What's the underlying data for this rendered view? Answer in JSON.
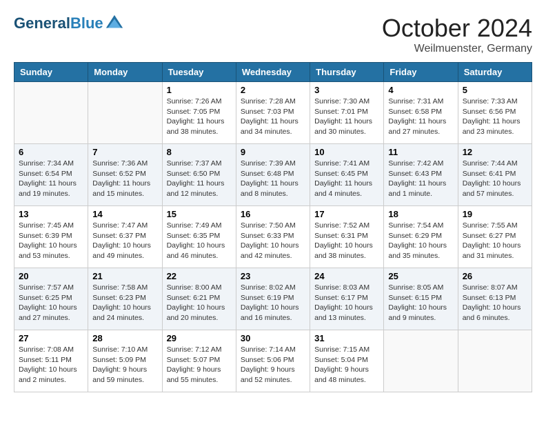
{
  "header": {
    "logo_line1": "General",
    "logo_line2": "Blue",
    "month_title": "October 2024",
    "subtitle": "Weilmuenster, Germany"
  },
  "weekdays": [
    "Sunday",
    "Monday",
    "Tuesday",
    "Wednesday",
    "Thursday",
    "Friday",
    "Saturday"
  ],
  "weeks": [
    [
      {
        "day": "",
        "sunrise": "",
        "sunset": "",
        "daylight": ""
      },
      {
        "day": "",
        "sunrise": "",
        "sunset": "",
        "daylight": ""
      },
      {
        "day": "1",
        "sunrise": "Sunrise: 7:26 AM",
        "sunset": "Sunset: 7:05 PM",
        "daylight": "Daylight: 11 hours and 38 minutes."
      },
      {
        "day": "2",
        "sunrise": "Sunrise: 7:28 AM",
        "sunset": "Sunset: 7:03 PM",
        "daylight": "Daylight: 11 hours and 34 minutes."
      },
      {
        "day": "3",
        "sunrise": "Sunrise: 7:30 AM",
        "sunset": "Sunset: 7:01 PM",
        "daylight": "Daylight: 11 hours and 30 minutes."
      },
      {
        "day": "4",
        "sunrise": "Sunrise: 7:31 AM",
        "sunset": "Sunset: 6:58 PM",
        "daylight": "Daylight: 11 hours and 27 minutes."
      },
      {
        "day": "5",
        "sunrise": "Sunrise: 7:33 AM",
        "sunset": "Sunset: 6:56 PM",
        "daylight": "Daylight: 11 hours and 23 minutes."
      }
    ],
    [
      {
        "day": "6",
        "sunrise": "Sunrise: 7:34 AM",
        "sunset": "Sunset: 6:54 PM",
        "daylight": "Daylight: 11 hours and 19 minutes."
      },
      {
        "day": "7",
        "sunrise": "Sunrise: 7:36 AM",
        "sunset": "Sunset: 6:52 PM",
        "daylight": "Daylight: 11 hours and 15 minutes."
      },
      {
        "day": "8",
        "sunrise": "Sunrise: 7:37 AM",
        "sunset": "Sunset: 6:50 PM",
        "daylight": "Daylight: 11 hours and 12 minutes."
      },
      {
        "day": "9",
        "sunrise": "Sunrise: 7:39 AM",
        "sunset": "Sunset: 6:48 PM",
        "daylight": "Daylight: 11 hours and 8 minutes."
      },
      {
        "day": "10",
        "sunrise": "Sunrise: 7:41 AM",
        "sunset": "Sunset: 6:45 PM",
        "daylight": "Daylight: 11 hours and 4 minutes."
      },
      {
        "day": "11",
        "sunrise": "Sunrise: 7:42 AM",
        "sunset": "Sunset: 6:43 PM",
        "daylight": "Daylight: 11 hours and 1 minute."
      },
      {
        "day": "12",
        "sunrise": "Sunrise: 7:44 AM",
        "sunset": "Sunset: 6:41 PM",
        "daylight": "Daylight: 10 hours and 57 minutes."
      }
    ],
    [
      {
        "day": "13",
        "sunrise": "Sunrise: 7:45 AM",
        "sunset": "Sunset: 6:39 PM",
        "daylight": "Daylight: 10 hours and 53 minutes."
      },
      {
        "day": "14",
        "sunrise": "Sunrise: 7:47 AM",
        "sunset": "Sunset: 6:37 PM",
        "daylight": "Daylight: 10 hours and 49 minutes."
      },
      {
        "day": "15",
        "sunrise": "Sunrise: 7:49 AM",
        "sunset": "Sunset: 6:35 PM",
        "daylight": "Daylight: 10 hours and 46 minutes."
      },
      {
        "day": "16",
        "sunrise": "Sunrise: 7:50 AM",
        "sunset": "Sunset: 6:33 PM",
        "daylight": "Daylight: 10 hours and 42 minutes."
      },
      {
        "day": "17",
        "sunrise": "Sunrise: 7:52 AM",
        "sunset": "Sunset: 6:31 PM",
        "daylight": "Daylight: 10 hours and 38 minutes."
      },
      {
        "day": "18",
        "sunrise": "Sunrise: 7:54 AM",
        "sunset": "Sunset: 6:29 PM",
        "daylight": "Daylight: 10 hours and 35 minutes."
      },
      {
        "day": "19",
        "sunrise": "Sunrise: 7:55 AM",
        "sunset": "Sunset: 6:27 PM",
        "daylight": "Daylight: 10 hours and 31 minutes."
      }
    ],
    [
      {
        "day": "20",
        "sunrise": "Sunrise: 7:57 AM",
        "sunset": "Sunset: 6:25 PM",
        "daylight": "Daylight: 10 hours and 27 minutes."
      },
      {
        "day": "21",
        "sunrise": "Sunrise: 7:58 AM",
        "sunset": "Sunset: 6:23 PM",
        "daylight": "Daylight: 10 hours and 24 minutes."
      },
      {
        "day": "22",
        "sunrise": "Sunrise: 8:00 AM",
        "sunset": "Sunset: 6:21 PM",
        "daylight": "Daylight: 10 hours and 20 minutes."
      },
      {
        "day": "23",
        "sunrise": "Sunrise: 8:02 AM",
        "sunset": "Sunset: 6:19 PM",
        "daylight": "Daylight: 10 hours and 16 minutes."
      },
      {
        "day": "24",
        "sunrise": "Sunrise: 8:03 AM",
        "sunset": "Sunset: 6:17 PM",
        "daylight": "Daylight: 10 hours and 13 minutes."
      },
      {
        "day": "25",
        "sunrise": "Sunrise: 8:05 AM",
        "sunset": "Sunset: 6:15 PM",
        "daylight": "Daylight: 10 hours and 9 minutes."
      },
      {
        "day": "26",
        "sunrise": "Sunrise: 8:07 AM",
        "sunset": "Sunset: 6:13 PM",
        "daylight": "Daylight: 10 hours and 6 minutes."
      }
    ],
    [
      {
        "day": "27",
        "sunrise": "Sunrise: 7:08 AM",
        "sunset": "Sunset: 5:11 PM",
        "daylight": "Daylight: 10 hours and 2 minutes."
      },
      {
        "day": "28",
        "sunrise": "Sunrise: 7:10 AM",
        "sunset": "Sunset: 5:09 PM",
        "daylight": "Daylight: 9 hours and 59 minutes."
      },
      {
        "day": "29",
        "sunrise": "Sunrise: 7:12 AM",
        "sunset": "Sunset: 5:07 PM",
        "daylight": "Daylight: 9 hours and 55 minutes."
      },
      {
        "day": "30",
        "sunrise": "Sunrise: 7:14 AM",
        "sunset": "Sunset: 5:06 PM",
        "daylight": "Daylight: 9 hours and 52 minutes."
      },
      {
        "day": "31",
        "sunrise": "Sunrise: 7:15 AM",
        "sunset": "Sunset: 5:04 PM",
        "daylight": "Daylight: 9 hours and 48 minutes."
      },
      {
        "day": "",
        "sunrise": "",
        "sunset": "",
        "daylight": ""
      },
      {
        "day": "",
        "sunrise": "",
        "sunset": "",
        "daylight": ""
      }
    ]
  ]
}
